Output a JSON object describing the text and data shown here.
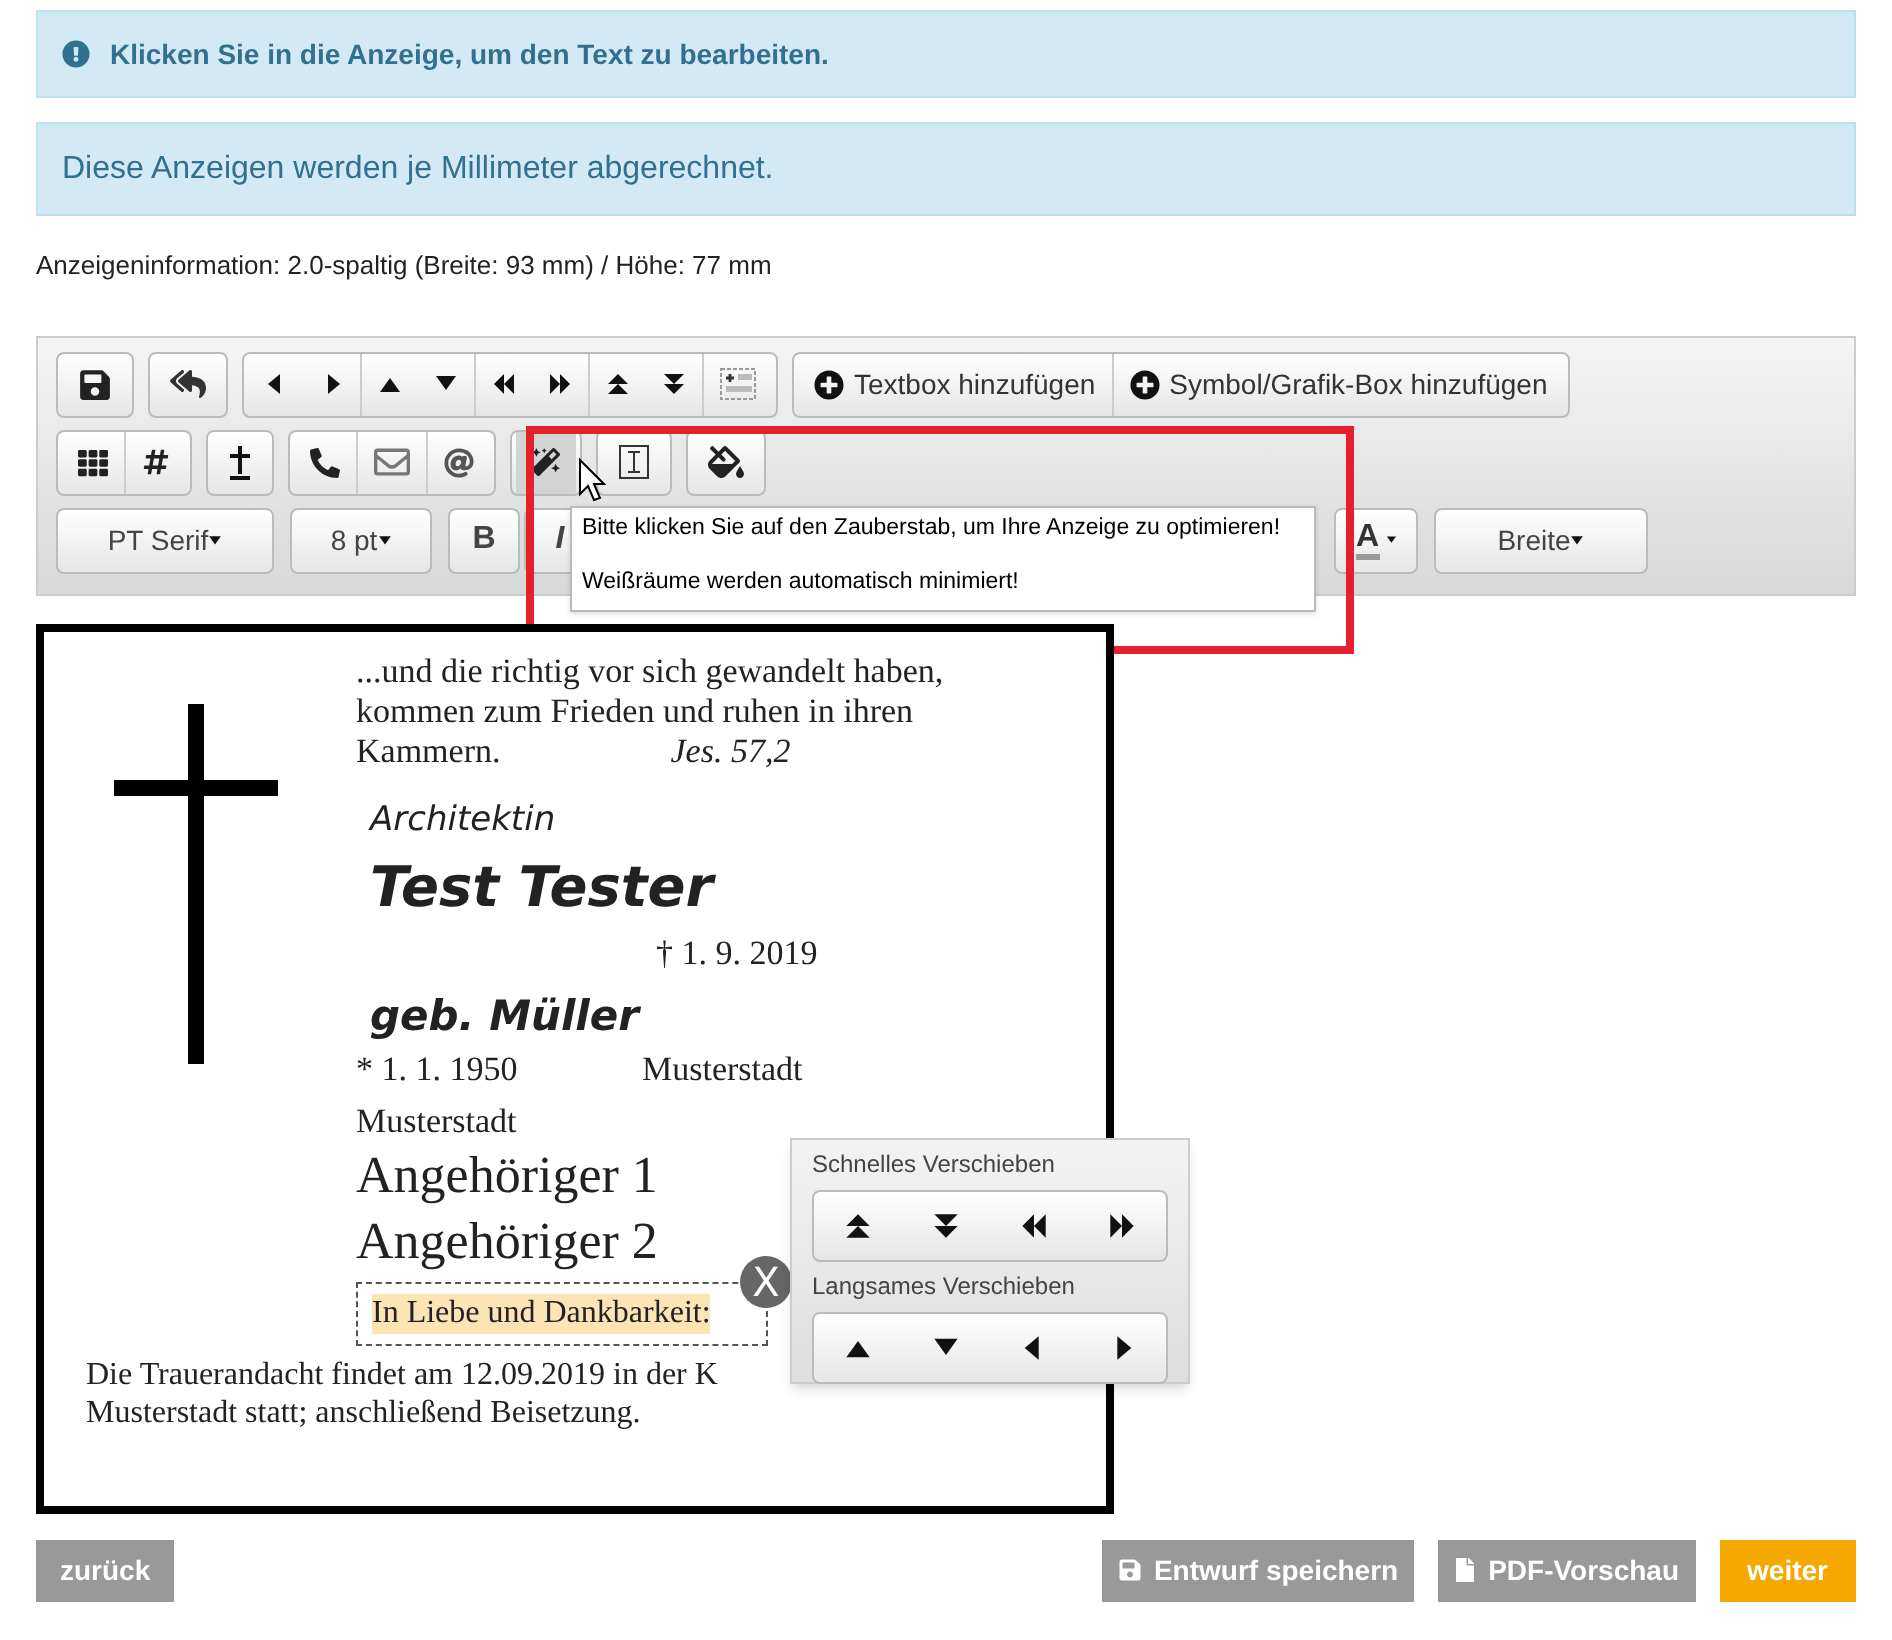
{
  "alerts": [
    {
      "kind": "icon",
      "text": "Klicken Sie in die Anzeige, um den Text zu bearbeiten."
    },
    {
      "kind": "plain",
      "text": "Diese Anzeigen werden je Millimeter abgerechnet."
    }
  ],
  "ad_info": "Anzeigeninformation: 2.0-spaltig (Breite: 93 mm) / Höhe: 77 mm",
  "toolbar": {
    "add_buttons": [
      "Textbox hinzufügen",
      "Symbol/Grafik-Box hinzufügen"
    ],
    "font_select": "PT Serif",
    "size_select": "8 pt",
    "bold": "B",
    "italic": "I",
    "color_button": "A",
    "width_select": "Breite",
    "tooltip": [
      "Bitte klicken Sie auf den Zauberstab, um Ihre Anzeige zu optimieren!",
      "Weißräume werden automatisch minimiert!"
    ]
  },
  "ad": {
    "verse": [
      "...und die richtig vor sich gewandelt haben,",
      "kommen zum Frieden und ruhen in ihren",
      "Kammern."
    ],
    "verse_source": "Jes. 57,2",
    "title": "Architektin",
    "name": "Test Tester",
    "death": "† 1. 9. 2019",
    "maiden_name": "geb. Müller",
    "birth": "* 1. 1. 1950",
    "birth_place": "Musterstadt",
    "residence": "Musterstadt",
    "relatives": [
      "Angehöriger 1",
      "Angehöriger 2"
    ],
    "selected_text": "In Liebe und Dankbarkeit:",
    "close_label": "X",
    "notice": [
      "Die Trauerandacht findet am 12.09.2019 in der K",
      "Musterstadt statt; anschließend Beisetzung."
    ]
  },
  "move_panel": {
    "fast_label": "Schnelles Verschieben",
    "slow_label": "Langsames Verschieben"
  },
  "footer": {
    "back": "zurück",
    "save": "Entwurf speichern",
    "preview": "PDF-Vorschau",
    "next": "weiter"
  }
}
